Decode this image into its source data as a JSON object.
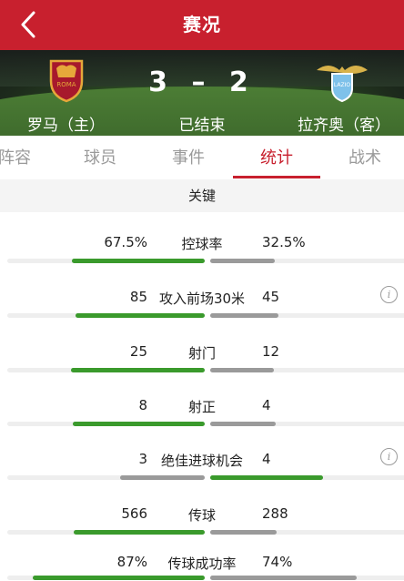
{
  "header": {
    "title": "赛况"
  },
  "match": {
    "home_name": "罗马（主）",
    "away_name": "拉齐奥（客）",
    "score": "3 – 2",
    "status": "已结束",
    "home_crest_text": "ROMA",
    "away_crest_text": "LAZIO"
  },
  "tabs": [
    {
      "label": "阵容"
    },
    {
      "label": "球员"
    },
    {
      "label": "事件"
    },
    {
      "label": "统计"
    },
    {
      "label": "战术"
    }
  ],
  "active_tab": "统计",
  "section": {
    "title": "关键"
  },
  "stats": [
    {
      "label": "控球率",
      "home": "67.5%",
      "away": "32.5%",
      "home_fraction": 0.675,
      "away_fraction": 0.325,
      "winner": "home",
      "has_info": false
    },
    {
      "label": "攻入前场30米",
      "home": "85",
      "away": "45",
      "home_fraction": 0.654,
      "away_fraction": 0.346,
      "winner": "home",
      "has_info": true
    },
    {
      "label": "射门",
      "home": "25",
      "away": "12",
      "home_fraction": 0.676,
      "away_fraction": 0.324,
      "winner": "home",
      "has_info": false
    },
    {
      "label": "射正",
      "home": "8",
      "away": "4",
      "home_fraction": 0.667,
      "away_fraction": 0.333,
      "winner": "home",
      "has_info": false
    },
    {
      "label": "绝佳进球机会",
      "home": "3",
      "away": "4",
      "home_fraction": 0.429,
      "away_fraction": 0.571,
      "winner": "away",
      "has_info": true
    },
    {
      "label": "传球",
      "home": "566",
      "away": "288",
      "home_fraction": 0.663,
      "away_fraction": 0.337,
      "winner": "home",
      "has_info": false
    },
    {
      "label": "传球成功率",
      "home": "87%",
      "away": "74%",
      "home_fraction": 0.87,
      "away_fraction": 0.74,
      "winner": "home",
      "has_info": false
    }
  ],
  "colors": {
    "brand_red": "#c8202e",
    "win_green": "#3a9a2c",
    "lose_gray": "#9a9a9a"
  }
}
